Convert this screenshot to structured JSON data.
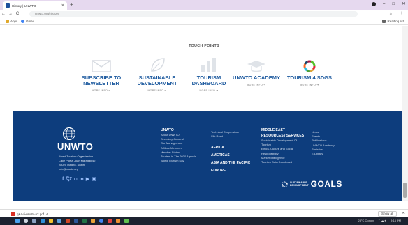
{
  "browser": {
    "tab_title": "History | UNWTO",
    "address": "unwto.org/history",
    "bookmarks": [
      "Apps",
      "Gmail"
    ],
    "reading_list": "Reading list"
  },
  "touch_points": {
    "title": "TOUCH POINTS",
    "items": [
      {
        "label": "SUBSCRIBE TO NEWSLETTER",
        "more": "MORE INFO"
      },
      {
        "label": "SUSTAINABLE DEVELOPMENT",
        "more": "MORE INFO"
      },
      {
        "label": "TOURISM DASHBOARD",
        "more": "MORE INFO"
      },
      {
        "label": "UNWTO ACADEMY",
        "more": "MORE INFO"
      },
      {
        "label": "TOURISM 4 SDGS",
        "more": "MORE INFO"
      }
    ]
  },
  "footer": {
    "logo": "UNWTO",
    "address": [
      "World Tourism Organization",
      "Calle Poeta Joan Maragall 42",
      "28020 Madrid, Spain",
      "info@unwto.org"
    ],
    "col1": {
      "heading": "UNWTO",
      "links": [
        "About UNWTO",
        "Secretary-General",
        "Our Management",
        "Affiliate Members",
        "Member States",
        "Tourism in The 2030 Agenda",
        "World Tourism Day"
      ]
    },
    "col2": {
      "links": [
        "Technical Cooperation",
        "Silk Road"
      ],
      "regions": [
        "AFRICA",
        "AMERICAS",
        "ASIA AND THE PACIFIC",
        "EUROPE"
      ]
    },
    "col3": {
      "heading1": "MIDDLE EAST",
      "heading2": "RESOURCES / SERVICES",
      "links": [
        "Sustainable Development Of",
        "Tourism",
        "Ethics, Culture and Social",
        "Responsibility",
        "Market Intelligence",
        "Tourism Data Dashboard"
      ]
    },
    "col4": {
      "links": [
        "News",
        "Events",
        "Publications",
        "UNWTO Academy",
        "Statistics",
        "E-Library"
      ]
    },
    "sdg_small": [
      "SUSTAINABLE",
      "DEVELOPMENT"
    ],
    "sdg_big": "GOALS"
  },
  "downloads": {
    "file": "q&a-ti-unwto-v2.pdf",
    "show_all": "Show all"
  },
  "taskbar": {
    "weather": "28°C Cloudy",
    "time": "9:14 PM"
  },
  "colors": {
    "footer_bg": "#0d3d7d",
    "accent_blue": "#1d5a9f"
  }
}
